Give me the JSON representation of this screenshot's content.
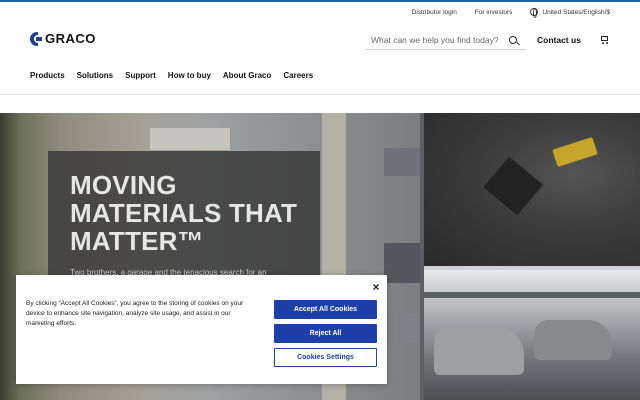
{
  "utility": {
    "distributor_login": "Distributor login",
    "for_investors": "For investors",
    "language": "United States/English/$"
  },
  "brand": {
    "name": "GRACO"
  },
  "search": {
    "placeholder": "What can we help you find today?"
  },
  "header": {
    "contact_label": "Contact us"
  },
  "nav": {
    "items": [
      {
        "label": "Products"
      },
      {
        "label": "Solutions"
      },
      {
        "label": "Support"
      },
      {
        "label": "How to buy"
      },
      {
        "label": "About Graco"
      },
      {
        "label": "Careers"
      }
    ]
  },
  "hero": {
    "title": "MOVING MATERIALS THAT MATTER™",
    "subtitle": "Two brothers, a garage and the tenacious search for an"
  },
  "cookie_banner": {
    "text": "By clicking “Accept All Cookies”, you agree to the storing of cookies on your device to enhance site navigation, analyze site usage, and assist in our marketing efforts.",
    "close_label": "×",
    "accept_label": "Accept All Cookies",
    "reject_label": "Reject All",
    "settings_label": "Cookies Settings"
  },
  "colors": {
    "accent": "#1e3fa8",
    "brand_blue": "#1f3f8f"
  }
}
